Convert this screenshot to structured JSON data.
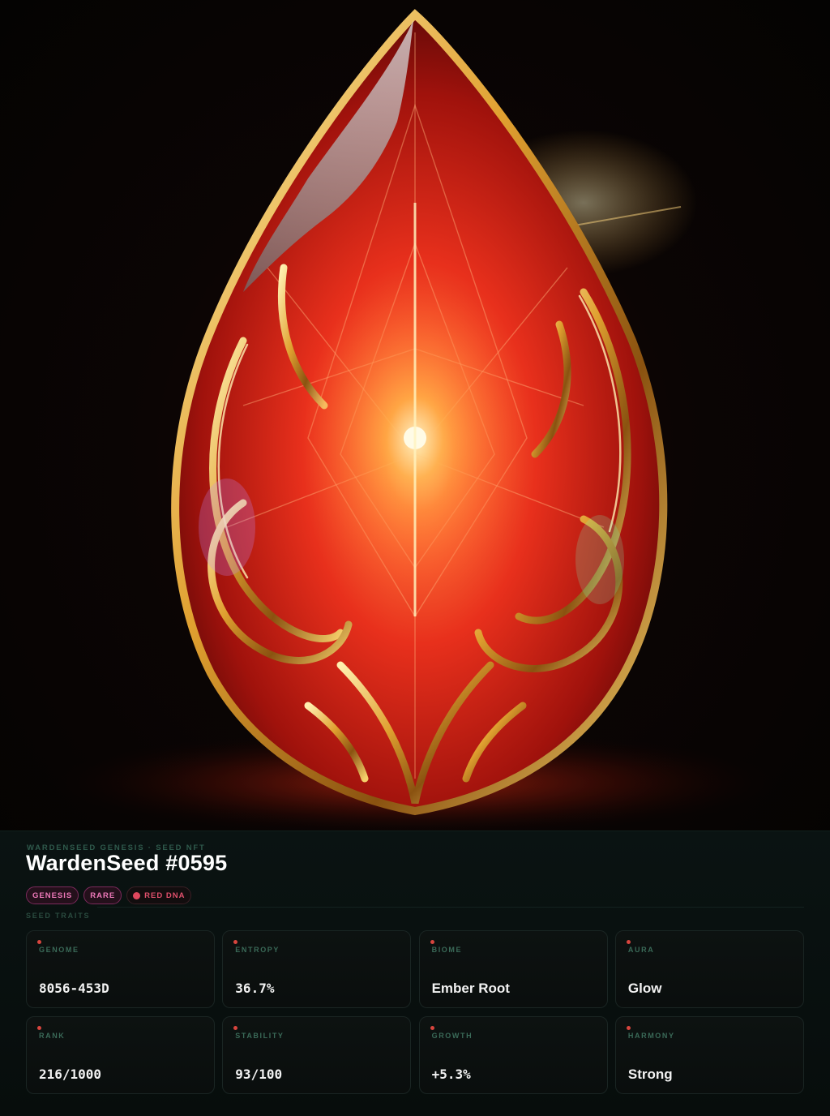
{
  "hero": {
    "alt_icon": "ruby-seed-artwork"
  },
  "header": {
    "eyebrow": "WARDENSEED GENESIS · SEED NFT",
    "title": "WardenSeed #0595"
  },
  "badges": [
    {
      "label": "GENESIS",
      "style": "pink"
    },
    {
      "label": "RARE",
      "style": "pink"
    },
    {
      "label": "RED DNA",
      "style": "red",
      "dot_color": "#e0475d"
    }
  ],
  "traits_label": "SEED TRAITS",
  "traits": [
    {
      "label": "GENOME",
      "value": "8056-453D",
      "mono": true
    },
    {
      "label": "ENTROPY",
      "value": "36.7%",
      "mono": true
    },
    {
      "label": "BIOME",
      "value": "Ember Root",
      "mono": false
    },
    {
      "label": "AURA",
      "value": "Glow",
      "mono": false
    },
    {
      "label": "RANK",
      "value": "216/1000",
      "mono": true
    },
    {
      "label": "STABILITY",
      "value": "93/100",
      "mono": true
    },
    {
      "label": "GROWTH",
      "value": "+5.3%",
      "mono": true
    },
    {
      "label": "HARMONY",
      "value": "Strong",
      "mono": false
    }
  ],
  "colors": {
    "accent_dot": "#d8453e",
    "label": "#3a6a58",
    "background": "#050807"
  }
}
